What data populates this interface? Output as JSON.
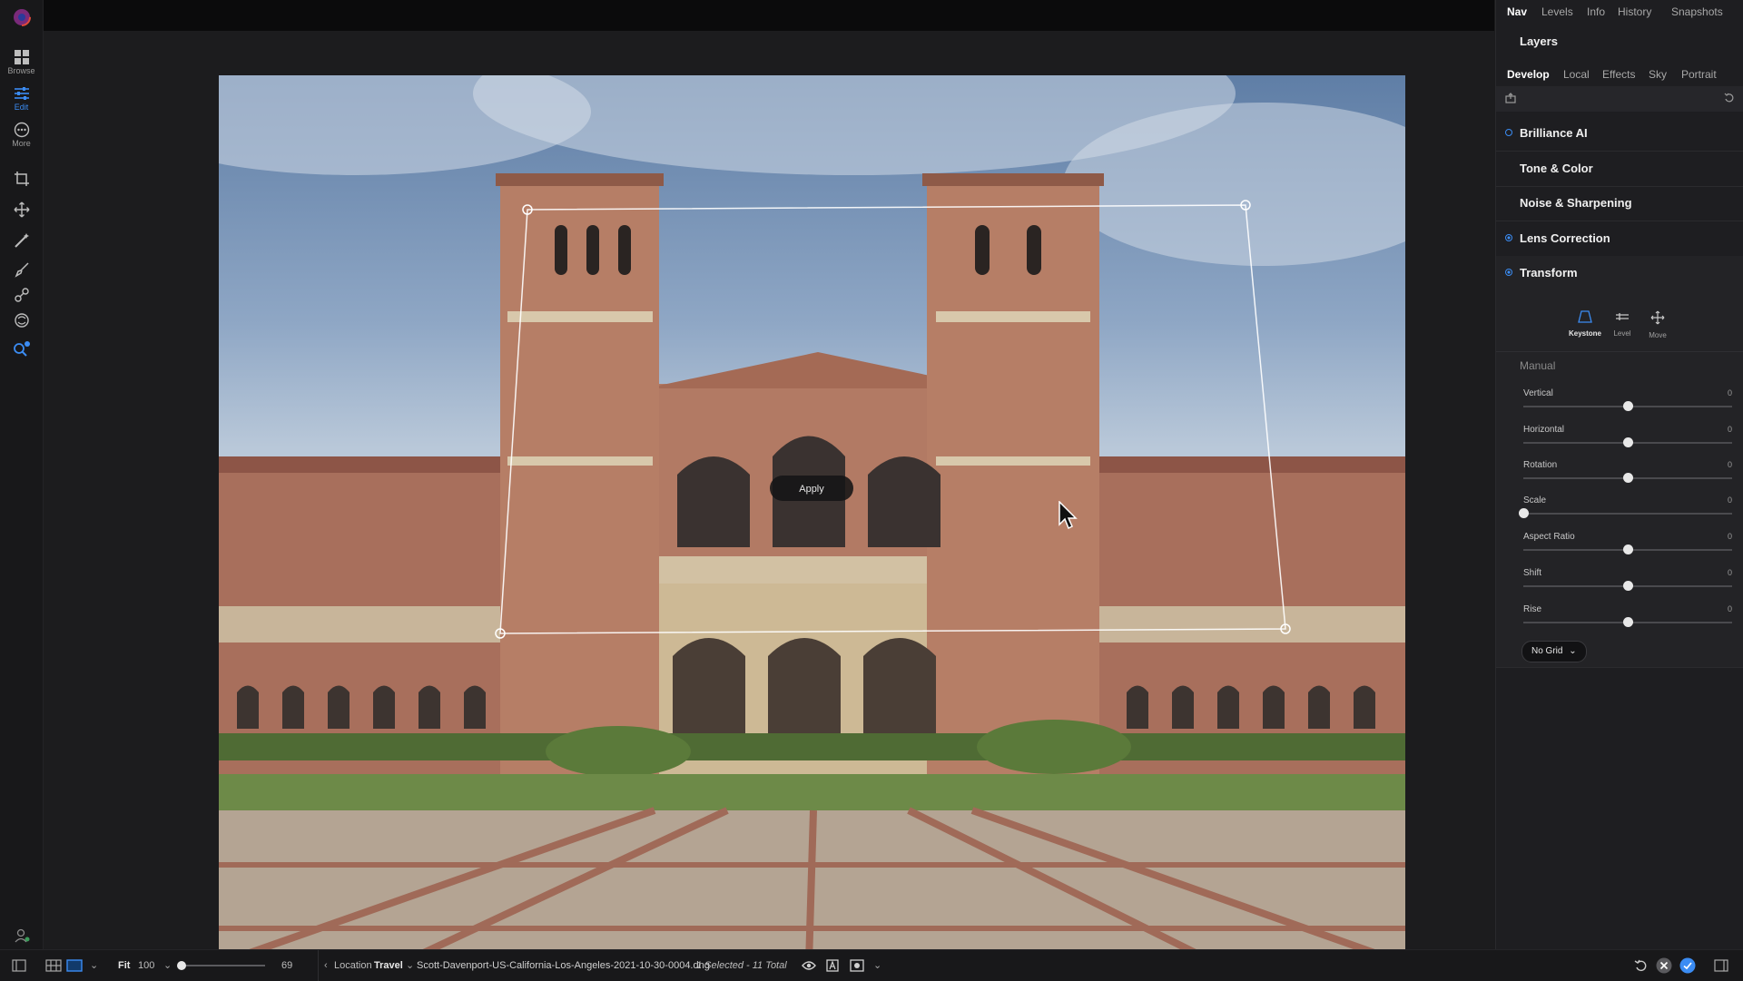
{
  "left_toolbar": {
    "items": [
      {
        "label": "Browse"
      },
      {
        "label": "Edit"
      },
      {
        "label": "More"
      }
    ]
  },
  "canvas": {
    "apply_label": "Apply"
  },
  "right_panel": {
    "top_tabs": [
      "Nav",
      "Levels",
      "Info",
      "History",
      "Snapshots"
    ],
    "layers_label": "Layers",
    "sub_tabs": [
      "Develop",
      "Local",
      "Effects",
      "Sky",
      "Portrait"
    ],
    "sections": [
      {
        "name": "Brilliance AI"
      },
      {
        "name": "Tone & Color"
      },
      {
        "name": "Noise & Sharpening"
      },
      {
        "name": "Lens Correction"
      },
      {
        "name": "Transform"
      }
    ],
    "transform": {
      "modes": [
        {
          "label": "Keystone"
        },
        {
          "label": "Level"
        },
        {
          "label": "Move"
        }
      ],
      "manual_label": "Manual",
      "sliders": [
        {
          "label": "Vertical",
          "value": "0",
          "position": 0.5
        },
        {
          "label": "Horizontal",
          "value": "0",
          "position": 0.5
        },
        {
          "label": "Rotation",
          "value": "0",
          "position": 0.5
        },
        {
          "label": "Scale",
          "value": "0",
          "position": 0.0
        },
        {
          "label": "Aspect Ratio",
          "value": "0",
          "position": 0.5
        },
        {
          "label": "Shift",
          "value": "0",
          "position": 0.5
        },
        {
          "label": "Rise",
          "value": "0",
          "position": 0.5
        }
      ],
      "grid_select": "No Grid"
    }
  },
  "bottom_bar": {
    "fit_label": "Fit",
    "zoom_value": "100",
    "slider_value": "69",
    "slider_position": 0.0,
    "location_label": "Location",
    "location_value": "Travel",
    "filename": "Scott-Davenport-US-California-Los-Angeles-2021-10-30-0004.dng",
    "selection_status": "1 Selected - 11 Total"
  },
  "colors": {
    "accent": "#3b8cf3",
    "panel": "#1e1e21",
    "canvas": "#1c1c1e"
  }
}
